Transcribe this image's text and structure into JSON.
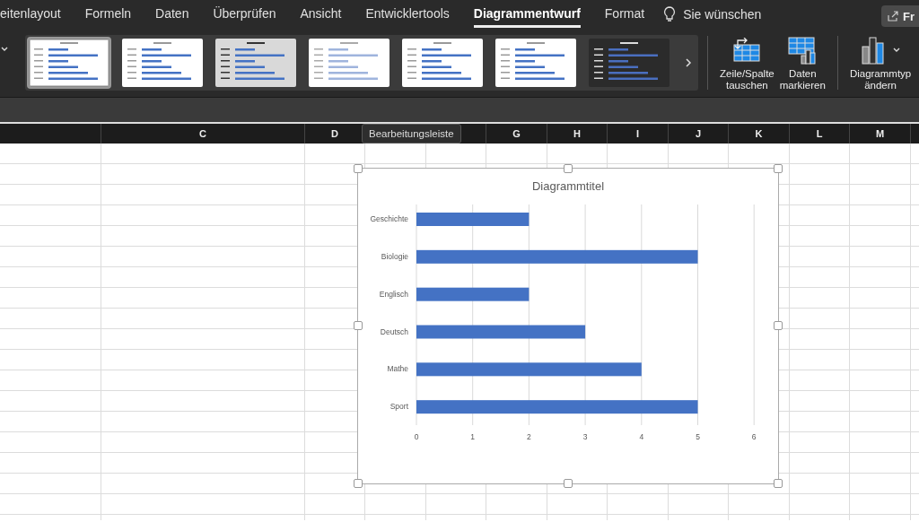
{
  "ribbon_tabs": [
    {
      "label": "eitenlayout",
      "selected": false
    },
    {
      "label": "Formeln",
      "selected": false
    },
    {
      "label": "Daten",
      "selected": false
    },
    {
      "label": "Überprüfen",
      "selected": false
    },
    {
      "label": "Ansicht",
      "selected": false
    },
    {
      "label": "Entwicklertools",
      "selected": false
    },
    {
      "label": "Diagrammentwurf",
      "selected": true
    },
    {
      "label": "Format",
      "selected": false
    }
  ],
  "tell_me": {
    "label": "Sie wünschen"
  },
  "share_button": {
    "label": "Fr"
  },
  "chart_styles": [
    {
      "kind": "light",
      "selected": true
    },
    {
      "kind": "light",
      "selected": false
    },
    {
      "kind": "gray",
      "selected": false
    },
    {
      "kind": "pale",
      "selected": false
    },
    {
      "kind": "light",
      "selected": false
    },
    {
      "kind": "light",
      "selected": false
    },
    {
      "kind": "dark",
      "selected": false
    }
  ],
  "ribbon_buttons": [
    {
      "kind": "swap",
      "label": [
        "Zeile/Spalte",
        "tauschen"
      ]
    },
    {
      "kind": "select",
      "label": [
        "Daten",
        "markieren"
      ]
    },
    {
      "kind": "charttype",
      "label": [
        "Diagrammtyp",
        "ändern"
      ]
    }
  ],
  "columns": [
    {},
    {
      "label": "C"
    },
    {
      "label": "D"
    },
    {},
    {},
    {
      "label": "G"
    },
    {
      "label": "H"
    },
    {
      "label": "I"
    },
    {
      "label": "J"
    },
    {
      "label": "K"
    },
    {
      "label": "L"
    },
    {
      "label": "M"
    }
  ],
  "tooltip": {
    "text": "Bearbeitungsleiste"
  },
  "chart": {
    "chart_data": {
      "type": "bar",
      "orientation": "horizontal",
      "title": "Diagrammtitel",
      "categories": [
        "Geschichte",
        "Biologie",
        "Englisch",
        "Deutsch",
        "Mathe",
        "Sport"
      ],
      "series": [
        {
          "color": "#4472c4",
          "values": [
            2,
            5,
            2,
            3,
            4,
            5
          ]
        }
      ],
      "xlim": [
        0,
        6
      ],
      "xticks": [
        0,
        1,
        2,
        3,
        4,
        5,
        6
      ],
      "grid": true
    }
  }
}
